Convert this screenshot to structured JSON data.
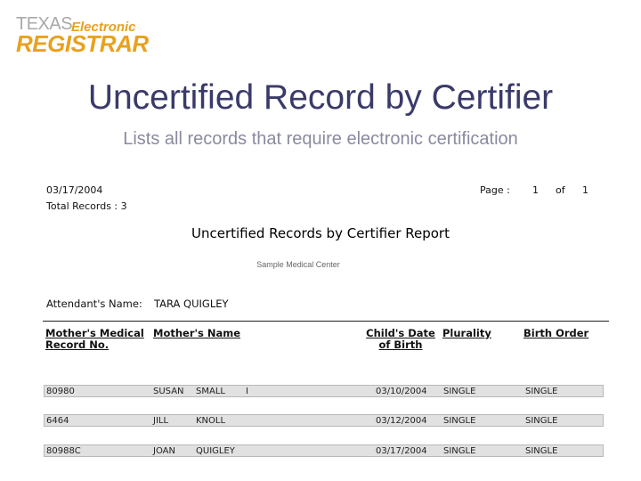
{
  "logo": {
    "texas": "TEXAS",
    "electronic": "Electronic",
    "registrar": "REGISTRAR",
    "colors": {
      "gray": "#a9a9a9",
      "orange": "#e8a11f"
    }
  },
  "slide": {
    "title": "Uncertified Record by Certifier",
    "subtitle": "Lists all records that require electronic certification"
  },
  "report": {
    "date": "03/17/2004",
    "total_records": "Total Records : 3",
    "page_label": "Page :",
    "page_number": "1",
    "page_of": "of",
    "page_total": "1",
    "title": "Uncertified Records by Certifier Report",
    "facility": "Sample Medical Center",
    "attendant_label": "Attendant's Name:",
    "attendant_value": "TARA QUIGLEY",
    "columns": {
      "mrn": "Mother's Medical Record No.",
      "name": "Mother's Name",
      "dob": "Child's Date of Birth",
      "plurality": "Plurality",
      "birth_order": "Birth Order"
    },
    "rows": [
      {
        "mrn": "80980",
        "first": "SUSAN",
        "last": "SMALL",
        "mi": "I",
        "dob": "03/10/2004",
        "plurality": "SINGLE",
        "birth_order": "SINGLE"
      },
      {
        "mrn": "6464",
        "first": "JILL",
        "last": "KNOLL",
        "mi": "",
        "dob": "03/12/2004",
        "plurality": "SINGLE",
        "birth_order": "SINGLE"
      },
      {
        "mrn": "80988C",
        "first": "JOAN",
        "last": "QUIGLEY",
        "mi": "",
        "dob": "03/17/2004",
        "plurality": "SINGLE",
        "birth_order": "SINGLE"
      }
    ]
  }
}
